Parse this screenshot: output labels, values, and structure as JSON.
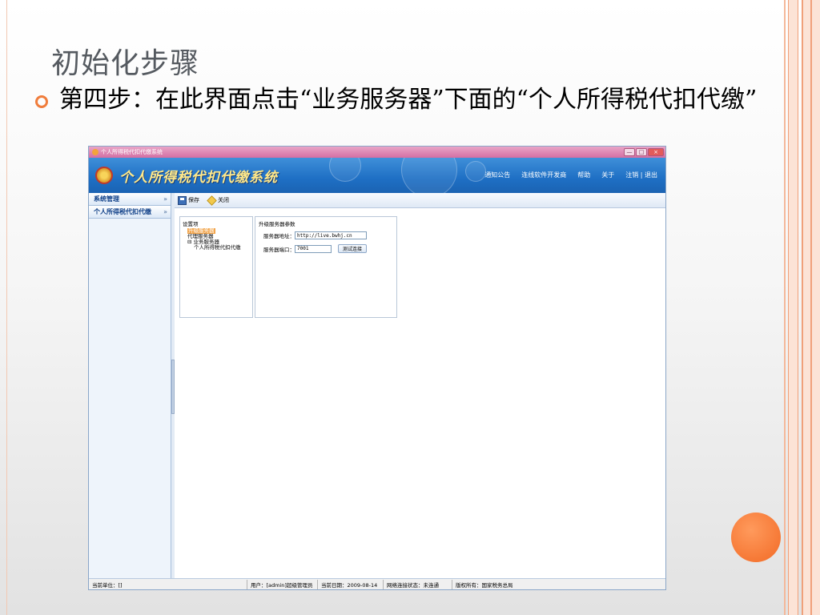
{
  "slide": {
    "title": "初始化步骤",
    "body": "第四步：在此界面点击“业务服务器”下面的“个人所得税代扣代缴”"
  },
  "app": {
    "window_title": "个人所得税代扣代缴系统",
    "window_controls": {
      "minimize": "—",
      "maximize": "□",
      "close": "×"
    },
    "banner_title": "个人所得税代扣代缴系统",
    "nav": [
      "通知公告",
      "连线软件开发商",
      "帮助",
      "关于",
      "注销 | 退出"
    ],
    "sidebar": [
      {
        "label": "系统管理",
        "chev": "»"
      },
      {
        "label": "个人所得税代扣代缴",
        "chev": "»"
      }
    ],
    "toolbar": {
      "save": "保存",
      "close": "关闭"
    },
    "tree": {
      "root": "设置项",
      "selected": "升级服务器",
      "node2": "代理服务器",
      "node3": "业务服务器",
      "expander": "⊟",
      "child": "个人所得税代扣代缴"
    },
    "params": {
      "title": "升级服务器参数",
      "address_label": "服务器地址：",
      "address_value": "http://live.bwhj.cn",
      "port_label": "服务器端口：",
      "port_value": "7001",
      "test_button": "测试连接"
    },
    "status": {
      "unit": "当前单位：[]",
      "user": "用户：[admin]超级管理员",
      "date": "当前日期：2009-08-14",
      "network": "网络连接状态：未连通",
      "copyright": "版权所有：国家税务总局"
    },
    "colors": {
      "accent": "#1e6fc4",
      "title_bar": "#d46fa3",
      "selection": "#f2a44a",
      "bullet": "#f07d3c"
    }
  }
}
